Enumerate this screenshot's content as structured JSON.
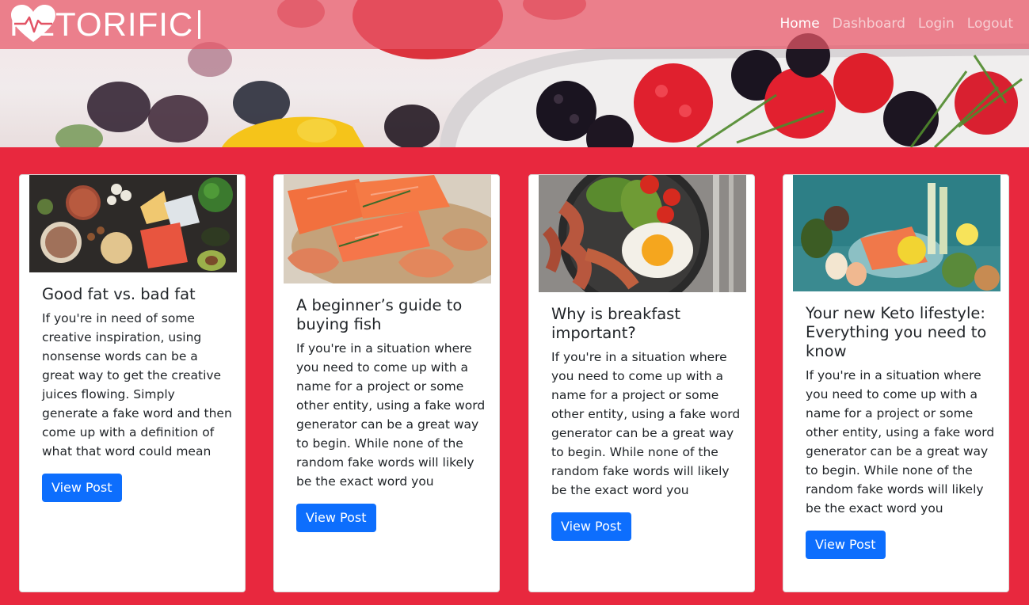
{
  "brand": {
    "name": "KETORIFIC"
  },
  "nav": {
    "items": [
      {
        "label": "Home",
        "active": true
      },
      {
        "label": "Dashboard",
        "active": false
      },
      {
        "label": "Login",
        "active": false
      },
      {
        "label": "Logout",
        "active": false
      }
    ]
  },
  "colors": {
    "page_background": "#e8283e",
    "navbar_overlay": "#e85868",
    "button": "#0d6efd",
    "card": "#ffffff"
  },
  "posts": [
    {
      "title": "Good fat vs. bad fat",
      "body": "If you're in need of some creative inspiration, using nonsense words can be a great way to get the creative juices flowing. Simply generate a fake word and then come up with a definition of what that word could mean",
      "button": "View Post",
      "image": "keto-foods-spread-image"
    },
    {
      "title": "A beginner’s guide to buying fish",
      "body": "If you're in a situation where you need to come up with a name for a project or some other entity, using a fake word generator can be a great way to begin. While none of the random fake words will likely be the exact word you",
      "button": "View Post",
      "image": "salmon-and-shrimp-image"
    },
    {
      "title": "Why is breakfast important?",
      "body": "If you're in a situation where you need to come up with a name for a project or some other entity, using a fake word generator can be a great way to begin. While none of the random fake words will likely be the exact word you",
      "button": "View Post",
      "image": "bacon-egg-avocado-breakfast-image"
    },
    {
      "title": "Your new Keto lifestyle: Everything you need to know",
      "body": "If you're in a situation where you need to come up with a name for a project or some other entity, using a fake word generator can be a great way to begin. While none of the random fake words will likely be the exact word you",
      "button": "View Post",
      "image": "salmon-eggs-vegetables-image"
    }
  ]
}
